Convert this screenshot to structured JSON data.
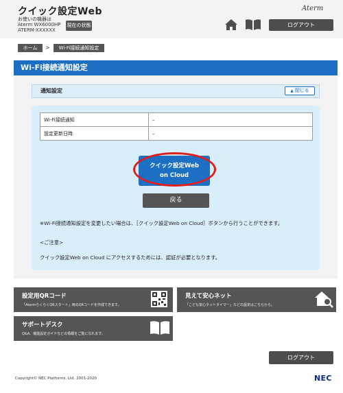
{
  "header": {
    "app_title": "クイック設定Web",
    "model_label": "お使いの機器は",
    "model_name": "Aterm WX6000HP",
    "device_id": "ATERM-XXXXXX",
    "status_button": "現在の状態",
    "brand": "Aterm",
    "logout_label": "ログアウト"
  },
  "breadcrumb": {
    "home": "ホーム",
    "separator": ">",
    "current": "Wi-Fi接続通知設定"
  },
  "page": {
    "title": "Wi-Fi接続通知設定",
    "section_title": "通知設定",
    "collapse_label": "閉じる",
    "table": [
      {
        "key": "Wi-Fi接続通知",
        "value": "–"
      },
      {
        "key": "設定更新日時",
        "value": "–"
      }
    ],
    "cloud_button_line1": "クイック設定Web",
    "cloud_button_line2": "on Cloud",
    "back_button": "戻る",
    "note_main": "※Wi-Fi接続通知設定を変更したい場合は、［クイック設定Web on Cloud］ボタンから行うことができます。",
    "note_heading": "<ご注意>",
    "note_detail": "クイック設定Web on Cloud にアクセスするためには、認証が必要となります。"
  },
  "tiles": {
    "qr_title": "設定用QRコード",
    "qr_desc": "「AtermらくらくQRスタート」用のQRコードを作成できます。",
    "safe_title": "見えて安心ネット",
    "safe_desc": "「こども安心ネットタイマー」などの設定はこちらから。",
    "support_title": "サポートデスク",
    "support_desc": "Q&A、機能設定ガイドなどの情報をご覧になれます。"
  },
  "footer": {
    "logout_label": "ログアウト",
    "copyright": "Copyright© NEC Platforms, Ltd. 2001-2020",
    "logo": "NEC"
  },
  "colors": {
    "accent_blue": "#1c6fc2",
    "button_gray": "#555555",
    "highlight_red": "#e01e1e"
  }
}
